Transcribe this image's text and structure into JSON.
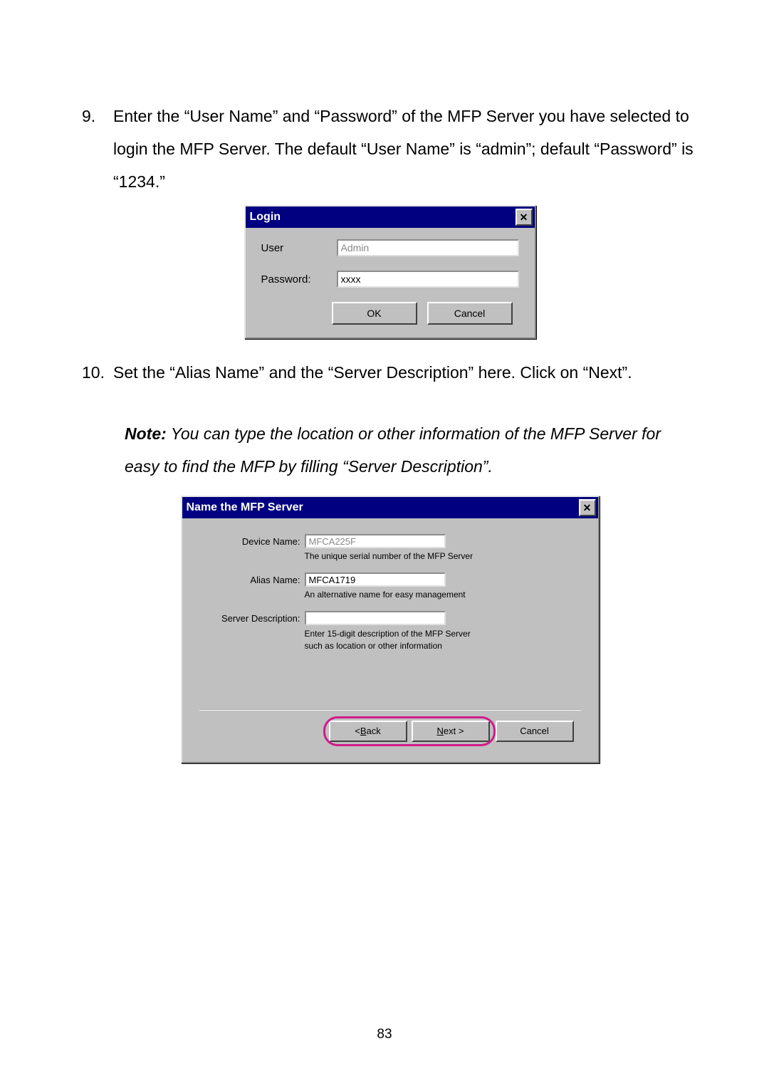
{
  "page_number": "83",
  "step9": {
    "num": "9.",
    "text": "Enter the “User Name” and “Password” of the MFP Server you have selected to login the MFP Server. The default “User Name” is “admin”; default “Password” is “1234.”"
  },
  "step10": {
    "num": "10.",
    "text": "Set the “Alias Name” and the “Server Description” here. Click on “Next”."
  },
  "note": {
    "label": "Note:",
    "text": " You can type the location or other information of the MFP Server for easy to find the MFP by filling “Server Description”."
  },
  "login_dialog": {
    "title": "Login",
    "close_glyph": "✕",
    "user_label": "User",
    "user_value": "Admin",
    "password_label": "Password:",
    "password_value": "xxxx",
    "ok": "OK",
    "cancel": "Cancel"
  },
  "name_dialog": {
    "title": "Name the MFP Server",
    "close_glyph": "✕",
    "device_name_label": "Device Name:",
    "device_name_value": "MFCA225F",
    "device_name_hint": "The unique serial number of the MFP Server",
    "alias_name_label": "Alias Name:",
    "alias_name_value": "MFCA1719",
    "alias_name_hint": "An alternative name for easy management",
    "server_desc_label": "Server Description:",
    "server_desc_value": "",
    "server_desc_hint1": "Enter 15-digit description of the MFP Server",
    "server_desc_hint2": "such as location or other information",
    "back_prefix": "< ",
    "back_u": "B",
    "back_suffix": "ack",
    "next_u": "N",
    "next_suffix": "ext >",
    "cancel": "Cancel"
  }
}
